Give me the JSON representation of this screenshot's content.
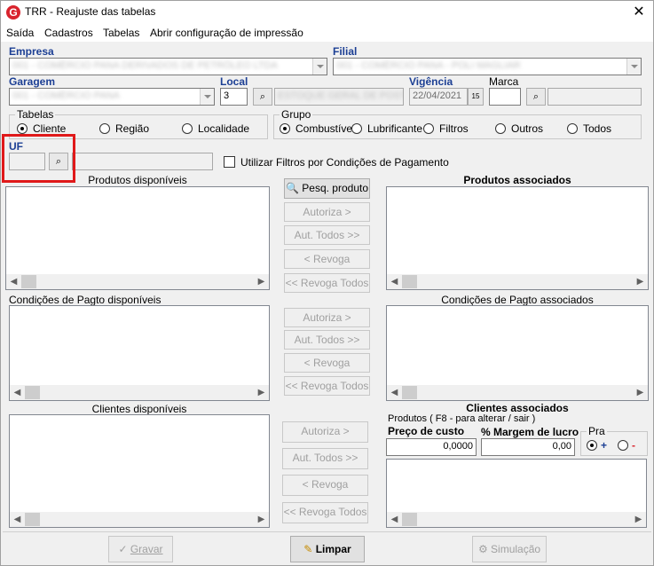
{
  "window": {
    "title": "TRR - Reajuste das tabelas",
    "close_glyph": "✕"
  },
  "menu": [
    "Saída",
    "Cadastros",
    "Tabelas",
    "Abrir configuração de impressão"
  ],
  "empresa": {
    "label": "Empresa",
    "value": "001 - COMÉRCIO PANA DERIVADOS DE PETRÓLEO LTDA"
  },
  "filial": {
    "label": "Filial",
    "value": "001 - COMÉRCIO PANA - POLI MAGLIAR"
  },
  "garagem": {
    "label": "Garagem",
    "value": "001 - COMÉRCIO PANA"
  },
  "local": {
    "label": "Local",
    "code": "3",
    "name": "ESTOQUE GERAL DE POSTOS"
  },
  "vigencia": {
    "label": "Vigência",
    "date": "22/04/2021",
    "cal_text": "15"
  },
  "marca": {
    "label": "Marca",
    "code": "",
    "name": ""
  },
  "tabelas": {
    "label": "Tabelas",
    "options": [
      "Cliente",
      "Região",
      "Localidade"
    ],
    "selected": "Cliente"
  },
  "grupo": {
    "label": "Grupo",
    "options": [
      "Combustível",
      "Lubrificante",
      "Filtros",
      "Outros",
      "Todos"
    ],
    "selected": "Combustível"
  },
  "uf": {
    "label": "UF",
    "value": ""
  },
  "utilizar_filtros": {
    "label": "Utilizar Filtros por Condições de Pagamento",
    "checked": false
  },
  "produtos_disponiveis": {
    "caption": "Produtos disponíveis"
  },
  "produtos_associados": {
    "caption": "Produtos associados"
  },
  "condicoes_disponiveis": {
    "caption": "Condições de Pagto disponíveis"
  },
  "condicoes_associados": {
    "caption": "Condições de Pagto associados"
  },
  "clientes_disponiveis": {
    "caption": "Clientes disponíveis"
  },
  "clientes_associados": {
    "caption": "Clientes associados"
  },
  "buttons": {
    "pesq_produto": "Pesq. produto",
    "autoriza": "Autoriza >",
    "aut_todos": "Aut. Todos >>",
    "revoga": "< Revoga",
    "revoga_todos": "<< Revoga Todos"
  },
  "produtos_hint": "Produtos ( F8 - para alterar / sair )",
  "preco_custo": {
    "label": "Preço de custo",
    "value": "0,0000"
  },
  "margem_lucro": {
    "label": "% Margem de lucro",
    "value": "0,00"
  },
  "pra": {
    "label": "Pra",
    "plus": "+",
    "minus": "-"
  },
  "footer": {
    "gravar": "Gravar",
    "limpar": "Limpar",
    "simulacao": "Simulação"
  },
  "colors": {
    "accent_label": "#1c3f94",
    "highlight": "#e0191a",
    "app_icon": "#d9232d"
  }
}
